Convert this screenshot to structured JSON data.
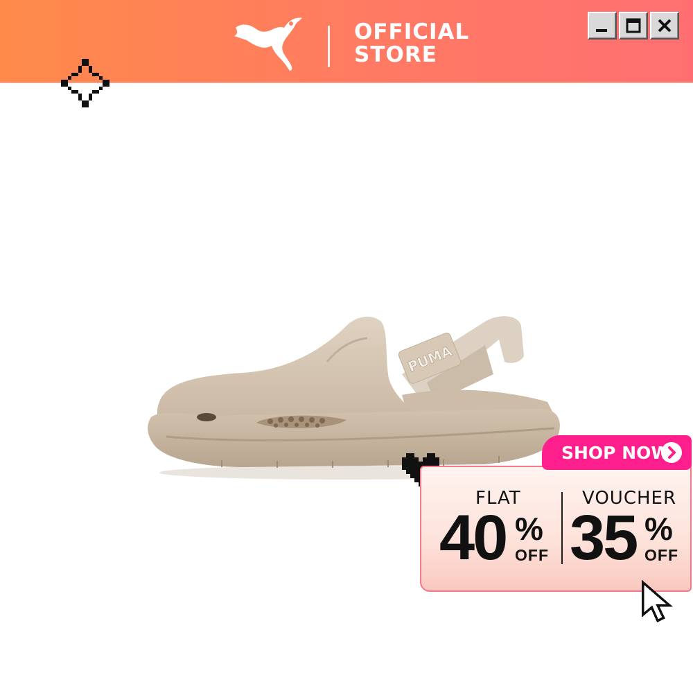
{
  "header": {
    "brand_line1": "OFFICIAL",
    "brand_line2": "STORE",
    "logo_icon": "puma-logo",
    "window_buttons": [
      "minimize",
      "maximize",
      "close"
    ],
    "gradient": [
      "#ff8a4a",
      "#ff6f72"
    ]
  },
  "product": {
    "icon": "beige-clog-sandal",
    "strap_text": "PUMA",
    "color": "#d4c4b0"
  },
  "promo": {
    "shop_now_label": "SHOP NOW",
    "flat_label": "FLAT",
    "flat_value": "40",
    "voucher_label": "VOUCHER",
    "voucher_value": "35",
    "percent_symbol": "%",
    "off_label": "OFF",
    "accent": "#ff1f8c"
  },
  "decor": [
    "sparkle-icon",
    "pixel-heart-icon",
    "pixel-cursor-icon"
  ]
}
